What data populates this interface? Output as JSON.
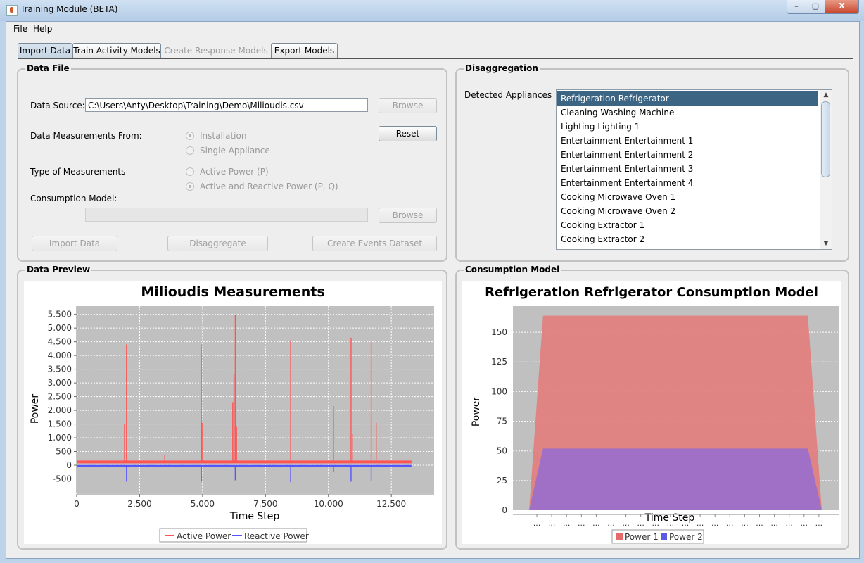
{
  "window": {
    "title": "Training Module (BETA)",
    "icon": "java-coffee-icon"
  },
  "window_controls": {
    "minimize": "–",
    "maximize": "▢",
    "close": "X"
  },
  "menu": [
    "File",
    "Help"
  ],
  "tabs": [
    {
      "label": "Import Data",
      "state": "selected"
    },
    {
      "label": "Train Activity Models",
      "state": "enabled"
    },
    {
      "label": "Create Response Models",
      "state": "disabled"
    },
    {
      "label": "Export Models",
      "state": "enabled"
    }
  ],
  "data_file": {
    "title": "Data File",
    "data_source_label": "Data Source:",
    "data_source_value": "C:\\Users\\Anty\\Desktop\\Training\\Demo\\Milioudis.csv",
    "browse1": "Browse",
    "reset": "Reset",
    "measurements_from_label": "Data Measurements From:",
    "measurements_from_options": [
      "Installation",
      "Single Appliance"
    ],
    "measurements_from_selected": "Installation",
    "type_label": "Type of Measurements",
    "type_options": [
      "Active Power (P)",
      "Active and Reactive Power (P, Q)"
    ],
    "type_selected": "Active and Reactive Power (P, Q)",
    "consumption_label": "Consumption Model:",
    "consumption_value": "",
    "browse2": "Browse",
    "import_button": "Import Data",
    "disaggregate_button": "Disaggregate",
    "events_button": "Create Events Dataset"
  },
  "disaggregation": {
    "title": "Disaggregation",
    "label": "Detected Appliances",
    "appliances": [
      "Refrigeration Refrigerator",
      "Cleaning Washing Machine",
      "Lighting Lighting 1",
      "Entertainment Entertainment 1",
      "Entertainment Entertainment 2",
      "Entertainment Entertainment 3",
      "Entertainment Entertainment 4",
      "Cooking Microwave Oven 1",
      "Cooking Microwave Oven 2",
      "Cooking Extractor 1",
      "Cooking Extractor 2"
    ],
    "selected_index": 0
  },
  "data_preview": {
    "title": "Data Preview"
  },
  "consumption_model": {
    "title": "Consumption Model"
  },
  "chart_data": [
    {
      "type": "line",
      "title": "Milioudis Measurements",
      "xlabel": "Time Step",
      "ylabel": "Power",
      "xlim": [
        0,
        14200
      ],
      "ylim": [
        -1000,
        5800
      ],
      "x_ticks": [
        "0",
        "2.500",
        "5.000",
        "7.500",
        "10.000",
        "12.500"
      ],
      "x_tick_values": [
        0,
        2500,
        5000,
        7500,
        10000,
        12500
      ],
      "y_ticks": [
        "-500",
        "0",
        "250",
        "500",
        "750",
        "1.000",
        "1.250",
        "1.500",
        "1.750",
        "2.000",
        "2.250",
        "2.500",
        "2.750",
        "3.000",
        "3.250",
        "3.500",
        "3.750",
        "4.000",
        "4.250",
        "4.500",
        "4.750",
        "5.000",
        "5.250",
        "5.500"
      ],
      "y_tick_values_note": "",
      "y_tick_labels": [
        "-500",
        "0",
        "500",
        "1.000",
        "1.500",
        "2.000",
        "2.500",
        "3.000",
        "3.500",
        "4.000",
        "4.500",
        "5.000",
        "5.500"
      ],
      "y_tick_label_values": [
        -500,
        0,
        500,
        1000,
        1500,
        2000,
        2500,
        3000,
        3500,
        4000,
        4500,
        5000,
        5500
      ],
      "grid": true,
      "legend_position": "bottom",
      "series": [
        {
          "name": "Active Power",
          "color": "#ff5555",
          "baseline": 120,
          "x_max": 13300,
          "spikes": [
            {
              "x": 1900,
              "y": 1500
            },
            {
              "x": 1980,
              "y": 4400
            },
            {
              "x": 3500,
              "y": 380
            },
            {
              "x": 4950,
              "y": 4400
            },
            {
              "x": 4980,
              "y": 1550
            },
            {
              "x": 6200,
              "y": 2300
            },
            {
              "x": 6250,
              "y": 3300
            },
            {
              "x": 6300,
              "y": 5500
            },
            {
              "x": 6350,
              "y": 1400
            },
            {
              "x": 8500,
              "y": 4550
            },
            {
              "x": 10200,
              "y": 2150
            },
            {
              "x": 10900,
              "y": 4650
            },
            {
              "x": 10950,
              "y": 1150
            },
            {
              "x": 11700,
              "y": 4550
            },
            {
              "x": 11900,
              "y": 1550
            }
          ]
        },
        {
          "name": "Reactive Power",
          "color": "#5555ff",
          "baseline": -30,
          "x_max": 13300,
          "spikes": [
            {
              "x": 1980,
              "y": -600
            },
            {
              "x": 4950,
              "y": -600
            },
            {
              "x": 6300,
              "y": -550
            },
            {
              "x": 8500,
              "y": -620
            },
            {
              "x": 10200,
              "y": -250
            },
            {
              "x": 10900,
              "y": -600
            },
            {
              "x": 11700,
              "y": -580
            }
          ]
        }
      ]
    },
    {
      "type": "area",
      "title": "Refrigeration Refrigerator Consumption Model",
      "xlabel": "Time Step",
      "ylabel": "Power",
      "ylim": [
        0,
        172
      ],
      "y_tick_labels": [
        "0",
        "25",
        "50",
        "75",
        "100",
        "125",
        "150"
      ],
      "y_tick_values": [
        0,
        25,
        50,
        75,
        100,
        125,
        150
      ],
      "x_tick_label": "...",
      "x_tick_count": 20,
      "grid": true,
      "legend_position": "bottom",
      "series": [
        {
          "name": "Power 1",
          "color": "#e08080",
          "values": [
            0,
            164,
            164,
            164,
            164,
            164,
            164,
            164,
            164,
            164,
            164,
            164,
            164,
            164,
            164,
            164,
            164,
            164,
            164,
            164,
            164,
            0
          ]
        },
        {
          "name": "Power 2",
          "color": "#9b6fc8",
          "values": [
            0,
            52,
            52,
            52,
            52,
            52,
            52,
            52,
            52,
            52,
            52,
            52,
            52,
            52,
            52,
            52,
            52,
            52,
            52,
            52,
            52,
            0
          ]
        }
      ]
    }
  ]
}
